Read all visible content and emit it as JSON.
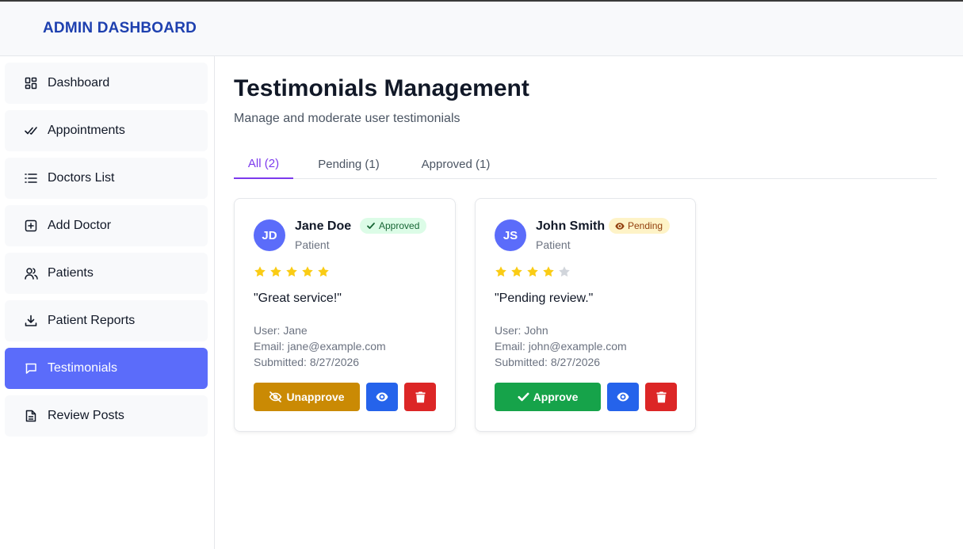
{
  "header": {
    "title": "ADMIN DASHBOARD"
  },
  "sidebar": {
    "items": [
      {
        "label": "Dashboard",
        "icon": "dashboard-grid-icon"
      },
      {
        "label": "Appointments",
        "icon": "double-check-icon"
      },
      {
        "label": "Doctors List",
        "icon": "list-icon"
      },
      {
        "label": "Add Doctor",
        "icon": "plus-square-icon"
      },
      {
        "label": "Patients",
        "icon": "users-icon"
      },
      {
        "label": "Patient Reports",
        "icon": "download-icon"
      },
      {
        "label": "Testimonials",
        "icon": "chat-bubble-icon",
        "active": true
      },
      {
        "label": "Review Posts",
        "icon": "document-icon"
      }
    ]
  },
  "page": {
    "title": "Testimonials Management",
    "subtitle": "Manage and moderate user testimonials"
  },
  "tabs": [
    {
      "label": "All (2)",
      "active": true
    },
    {
      "label": "Pending (1)",
      "active": false
    },
    {
      "label": "Approved (1)",
      "active": false
    }
  ],
  "testimonials": [
    {
      "initials": "JD",
      "name": "Jane Doe",
      "role": "Patient",
      "status": "Approved",
      "rating": 5,
      "max_rating": 5,
      "quote": "\"Great service!\"",
      "user": "User: Jane",
      "email": "Email: jane@example.com",
      "submitted": "Submitted: 8/27/2026",
      "action_label": "Unapprove"
    },
    {
      "initials": "JS",
      "name": "John Smith",
      "role": "Patient",
      "status": "Pending",
      "rating": 4,
      "max_rating": 5,
      "quote": "\"Pending review.\"",
      "user": "User: John",
      "email": "Email: john@example.com",
      "submitted": "Submitted: 8/27/2026",
      "action_label": "Approve"
    }
  ],
  "colors": {
    "brand": "#1e40af",
    "active_nav": "#5b6cfa",
    "tab_active": "#7c3aed",
    "unapprove": "#ca8a04",
    "approve": "#16a34a",
    "view": "#2563eb",
    "delete": "#dc2626",
    "star": "#facc15",
    "star_empty": "#d1d5db"
  }
}
